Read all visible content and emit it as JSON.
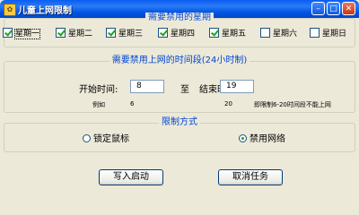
{
  "window": {
    "title": "儿童上网限制",
    "icon": "app-icon"
  },
  "weekdays_group": {
    "title": "需要禁用的星期",
    "days": [
      {
        "label": "星期一",
        "checked": true
      },
      {
        "label": "星期二",
        "checked": true
      },
      {
        "label": "星期三",
        "checked": true
      },
      {
        "label": "星期四",
        "checked": true
      },
      {
        "label": "星期五",
        "checked": true
      },
      {
        "label": "星期六",
        "checked": false
      },
      {
        "label": "星期日",
        "checked": false
      }
    ]
  },
  "time_group": {
    "title": "需要禁用上网的时间段(24小时制)",
    "start_label": "开始时间:",
    "start_value": "8",
    "to_label": "至",
    "end_label": "结束时间:",
    "end_value": "19",
    "example_label": "例如",
    "example_start": "6",
    "example_end": "20",
    "example_note": "即限制6-20时间段不能上网"
  },
  "mode_group": {
    "title": "限制方式",
    "options": [
      {
        "label": "锁定鼠标",
        "selected": false
      },
      {
        "label": "禁用网络",
        "selected": true
      }
    ]
  },
  "buttons": {
    "write_start": "写入启动",
    "cancel_task": "取消任务"
  },
  "colors": {
    "title_bar": "#0054E3",
    "group_title": "#0046D5",
    "window_bg": "#ECE9D8"
  }
}
